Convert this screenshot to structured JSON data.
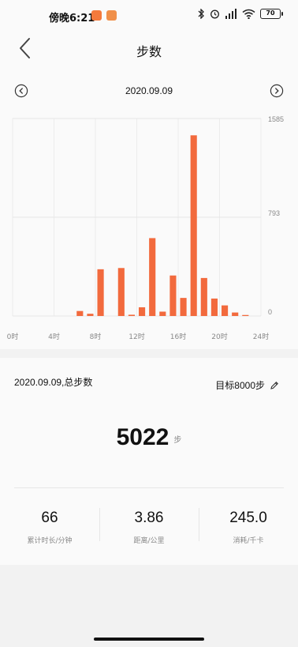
{
  "status_bar": {
    "time": "傍晚6:21",
    "battery": "70"
  },
  "header": {
    "title": "步数",
    "date": "2020.09.09"
  },
  "chart_data": {
    "type": "bar",
    "categories": [
      "0",
      "1",
      "2",
      "3",
      "4",
      "5",
      "6",
      "7",
      "8",
      "9",
      "10",
      "11",
      "12",
      "13",
      "14",
      "15",
      "16",
      "17",
      "18",
      "19",
      "20",
      "21",
      "22",
      "23"
    ],
    "values": [
      0,
      0,
      0,
      0,
      0,
      0,
      40,
      18,
      375,
      0,
      385,
      10,
      70,
      625,
      35,
      325,
      145,
      1450,
      305,
      140,
      85,
      28,
      8,
      0
    ],
    "x_tick_labels": [
      "0时",
      "4时",
      "8时",
      "12时",
      "16时",
      "20时",
      "24时"
    ],
    "y_tick_labels": [
      "1585",
      "793",
      "0"
    ],
    "ylim": [
      0,
      1585
    ],
    "grid": true,
    "bar_color": "#f26a3d"
  },
  "summary": {
    "date_label": "2020.09.09,总步数",
    "goal_label": "目标8000步",
    "total_steps": "5022",
    "steps_unit": "步",
    "stats": [
      {
        "value": "66",
        "label": "累计时长/分钟"
      },
      {
        "value": "3.86",
        "label": "距离/公里"
      },
      {
        "value": "245.0",
        "label": "消耗/千卡"
      }
    ]
  }
}
